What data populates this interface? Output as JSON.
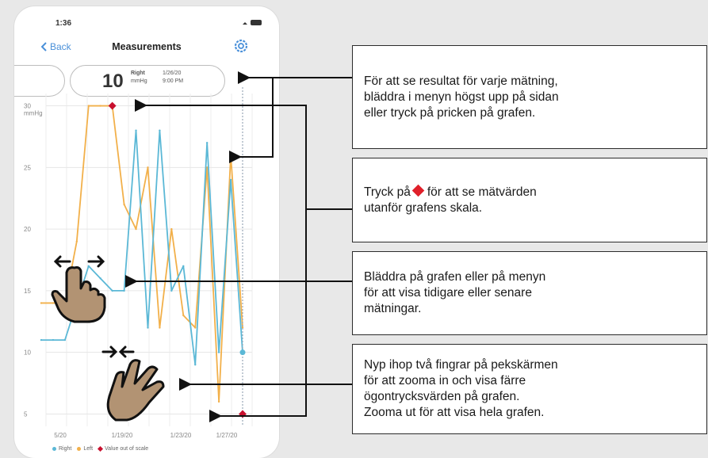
{
  "phone": {
    "status_time": "1:36",
    "nav": {
      "back_label": "Back",
      "title": "Measurements",
      "settings_icon": "gear-icon",
      "back_icon": "chevron-left-icon"
    },
    "selector": {
      "value": "10",
      "eye": "Right",
      "unit": "mmHg",
      "date": "1/26/20",
      "time": "9:00 PM"
    },
    "legend": {
      "right": "Right",
      "left": "Left",
      "out_of_scale": "Value out of scale"
    }
  },
  "colors": {
    "right_series": "#5bb8d6",
    "left_series": "#f2b04a",
    "out_of_scale": "#c8102e",
    "accent": "#4a90d9"
  },
  "chart_data": {
    "type": "line",
    "y_unit": "mmHg",
    "ylim": [
      4,
      31
    ],
    "y_ticks": [
      "30",
      "25",
      "20",
      "15",
      "10",
      "5"
    ],
    "x_ticks": [
      "5/20",
      "1/19/20",
      "1/23/20",
      "1/27/20"
    ],
    "grid": true,
    "series": [
      {
        "name": "Right",
        "values": [
          11,
          11,
          11,
          14,
          17,
          16,
          15,
          15,
          28,
          12,
          28,
          15,
          17,
          9,
          27,
          10,
          24,
          10
        ]
      },
      {
        "name": "Left",
        "values": [
          14,
          14,
          14,
          19,
          30,
          30,
          30,
          22,
          20,
          25,
          12,
          20,
          13,
          12,
          25,
          6,
          26,
          12
        ]
      }
    ],
    "out_of_scale_points": [
      {
        "index": 6,
        "value": 30
      },
      {
        "index": 17,
        "value": 5
      }
    ]
  },
  "callouts": [
    {
      "lines": [
        "För att se resultat för varje mätning,",
        "bläddra i menyn högst upp på sidan",
        "eller tryck på pricken på grafen."
      ]
    },
    {
      "before": "Tryck på",
      "after": "för att se mätvärden",
      "line2": "utanför grafens skala."
    },
    {
      "lines": [
        "Bläddra på grafen eller på menyn",
        "för att visa tidigare eller senare",
        "mätningar."
      ]
    },
    {
      "lines": [
        "Nyp ihop två fingrar på pekskärmen",
        "för att zooma in och visa färre",
        "ögontrycksvärden på grafen.",
        "Zooma ut för att visa hela grafen."
      ]
    }
  ],
  "gestures": {
    "swipe": "swipe-hand-icon",
    "pinch": "pinch-hand-icon"
  }
}
